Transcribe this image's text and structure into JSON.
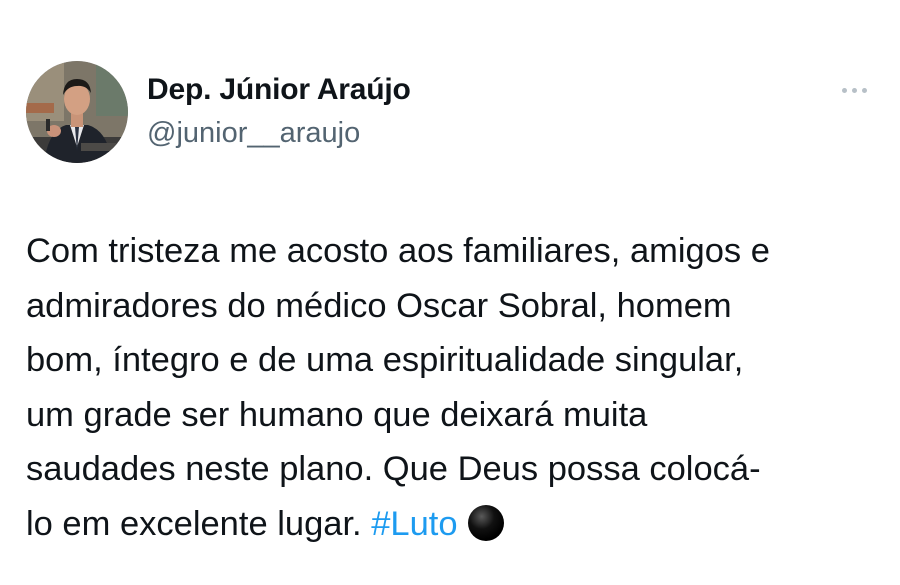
{
  "author": {
    "display_name": "Dep. Júnior Araújo",
    "handle": "@junior__araujo"
  },
  "menu": {
    "icon": "more-horizontal-icon"
  },
  "post": {
    "lines": [
      "Com tristeza me acosto aos familiares, amigos e",
      "admiradores do médico Oscar Sobral, homem",
      "bom, íntegro e de uma espiritualidade singular,",
      "um grade ser humano que deixará muita",
      "saudades neste plano. Que Deus possa colocá-",
      "lo em excelente lugar."
    ],
    "hashtag": "#Luto",
    "emoji": "black-circle-icon"
  },
  "colors": {
    "text": "#0f1419",
    "secondary": "#536471",
    "hashtag": "#1d9bf0",
    "background": "#ffffff"
  }
}
